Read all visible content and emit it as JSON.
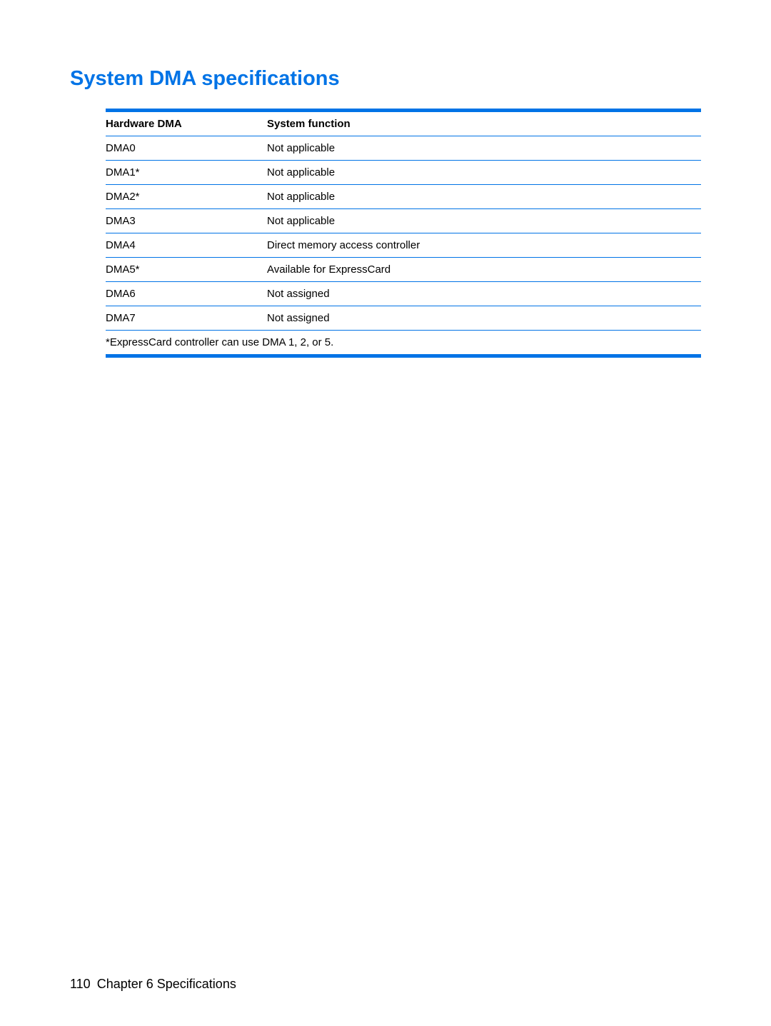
{
  "heading": "System DMA specifications",
  "table": {
    "headers": {
      "col1": "Hardware DMA",
      "col2": "System function"
    },
    "rows": [
      {
        "hardware": "DMA0",
        "function": "Not applicable"
      },
      {
        "hardware": "DMA1*",
        "function": "Not applicable"
      },
      {
        "hardware": "DMA2*",
        "function": "Not applicable"
      },
      {
        "hardware": "DMA3",
        "function": "Not applicable"
      },
      {
        "hardware": "DMA4",
        "function": "Direct memory access controller"
      },
      {
        "hardware": "DMA5*",
        "function": "Available for ExpressCard"
      },
      {
        "hardware": "DMA6",
        "function": "Not assigned"
      },
      {
        "hardware": "DMA7",
        "function": "Not assigned"
      }
    ],
    "footnote": "*ExpressCard controller can use DMA 1, 2, or 5."
  },
  "footer": {
    "pageNumber": "110",
    "chapterLabel": "Chapter 6   Specifications"
  }
}
